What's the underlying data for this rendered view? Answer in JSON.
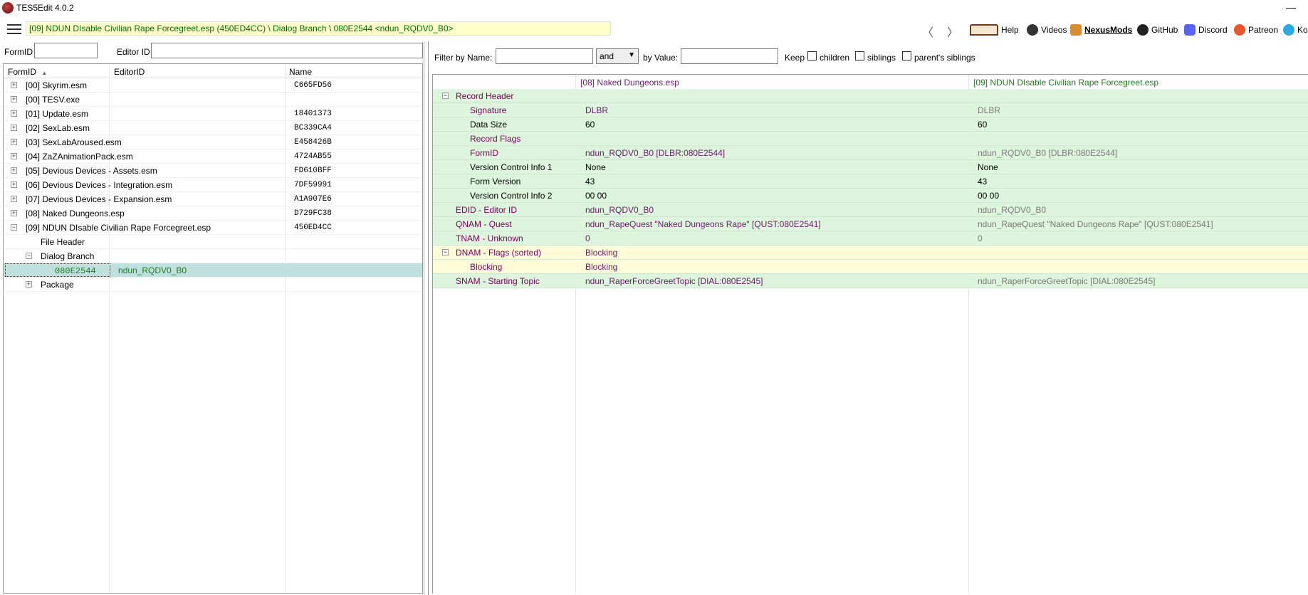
{
  "window": {
    "title": "TES5Edit 4.0.2",
    "minimize": "—"
  },
  "toolbar": {
    "path": "[09] NDUN DIsable Civilian Rape Forcegreet.esp (450ED4CC) \\ Dialog Branch \\ 080E2544 <ndun_RQDV0_B0>",
    "back": "〈",
    "forward": "〉",
    "links": {
      "help": "Help",
      "videos": "Videos",
      "nexus": "NexusMods",
      "github": "GitHub",
      "discord": "Discord",
      "patreon": "Patreon",
      "kofi": "Ko-"
    }
  },
  "left_filter": {
    "formid_label": "FormID",
    "editorid_label": "Editor ID"
  },
  "tree": {
    "headers": {
      "formid": "FormID",
      "editorid": "EditorID",
      "name": "Name"
    },
    "rows": [
      {
        "label": "[00] Skyrim.esm",
        "id": "C665FD56"
      },
      {
        "label": "[00] TESV.exe",
        "id": ""
      },
      {
        "label": "[01] Update.esm",
        "id": "18401373"
      },
      {
        "label": "[02] SexLab.esm",
        "id": "BC339CA4"
      },
      {
        "label": "[03] SexLabAroused.esm",
        "id": "E458426B"
      },
      {
        "label": "[04] ZaZAnimationPack.esm",
        "id": "4724AB55"
      },
      {
        "label": "[05] Devious Devices - Assets.esm",
        "id": "FD610BFF"
      },
      {
        "label": "[06] Devious Devices - Integration.esm",
        "id": "7DF59991"
      },
      {
        "label": "[07] Devious Devices - Expansion.esm",
        "id": "A1A907E6"
      },
      {
        "label": "[08] Naked Dungeons.esp",
        "id": "D729FC38"
      },
      {
        "label": "[09] NDUN DIsable Civilian Rape Forcegreet.esp",
        "id": "450ED4CC"
      }
    ],
    "file_header": "File Header",
    "dialog_branch": "Dialog Branch",
    "selected_formid": "080E2544",
    "selected_editorid": "ndun_RQDV0_B0",
    "package": "Package"
  },
  "right_filter": {
    "by_name": "Filter by Name:",
    "and": "and",
    "by_value": "by Value:",
    "keep": "Keep",
    "children": "children",
    "siblings": "siblings",
    "parents_siblings": "parent's siblings"
  },
  "grid": {
    "col1": "[08] Naked Dungeons.esp",
    "col2": "[09] NDUN DIsable Civilian Rape Forcegreet.esp",
    "record_header": "Record Header",
    "signature": {
      "name": "Signature",
      "v1": "DLBR",
      "v2": "DLBR"
    },
    "data_size": {
      "name": "Data Size",
      "v1": "60",
      "v2": "60"
    },
    "record_flags": {
      "name": "Record Flags"
    },
    "formid": {
      "name": "FormID",
      "v1": "ndun_RQDV0_B0 [DLBR:080E2544]",
      "v2": "ndun_RQDV0_B0 [DLBR:080E2544]"
    },
    "vci1": {
      "name": "Version Control Info 1",
      "v1": "None",
      "v2": "None"
    },
    "form_version": {
      "name": "Form Version",
      "v1": "43",
      "v2": "43"
    },
    "vci2": {
      "name": "Version Control Info 2",
      "v1": "00 00",
      "v2": "00 00"
    },
    "edid": {
      "name": "EDID - Editor ID",
      "v1": "ndun_RQDV0_B0",
      "v2": "ndun_RQDV0_B0"
    },
    "qnam": {
      "name": "QNAM - Quest",
      "v1": "ndun_RapeQuest \"Naked Dungeons Rape\" [QUST:080E2541]",
      "v2": "ndun_RapeQuest \"Naked Dungeons Rape\" [QUST:080E2541]"
    },
    "tnam": {
      "name": "TNAM - Unknown",
      "v1": "0",
      "v2": "0"
    },
    "dnam": {
      "name": "DNAM - Flags (sorted)",
      "v1": "Blocking"
    },
    "blocking": {
      "name": "Blocking",
      "v1": "Blocking"
    },
    "snam": {
      "name": "SNAM - Starting Topic",
      "v1": "ndun_RaperForceGreetTopic [DIAL:080E2545]",
      "v2": "ndun_RaperForceGreetTopic [DIAL:080E2545]"
    }
  }
}
